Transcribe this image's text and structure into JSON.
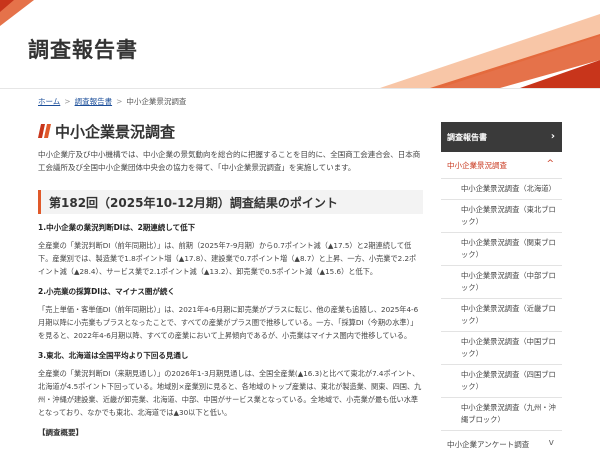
{
  "header": {
    "title": "調査報告書"
  },
  "breadcrumb": {
    "home": "ホーム",
    "reports": "調査報告書",
    "current": "中小企業景況調査",
    "separator": ">"
  },
  "main": {
    "title": "中小企業景況調査",
    "intro": "中小企業庁及び中小機構では、中小企業の景気動向を総合的に把握することを目的に、全国商工会連合会、日本商工会議所及び全国中小企業団体中央会の協力を得て、「中小企業景況調査」を実施しています。",
    "section_title": "第182回（2025年10-12月期）調査結果のポイント",
    "points": [
      {
        "heading": "1.中小企業の業況判断DIは、2期連続して低下",
        "body": "全産業の「業況判断DI（前年同期比）」は、前期（2025年7-9月期）から0.7ポイント減（▲17.5）と2期連続して低下。産業別では、製造業で1.8ポイント増（▲17.8）、建設業で0.7ポイント増（▲8.7）と上昇、一方、小売業で2.2ポイント減（▲28.4）、サービス業で2.1ポイント減（▲13.2）、卸売業で0.5ポイント減（▲15.6）と低下。"
      },
      {
        "heading": "2.小売業の採算DIは、マイナス圏が続く",
        "body": "「売上単価・客単価DI（前年同期比）」は、2021年4-6月期に卸売業がプラスに転じ、他の産業も追随し、2025年4-6月期以降に小売業もプラスとなったことで、すべての産業がプラス圏で推移している。一方、「採算DI（今期の水準）」を見ると、2022年4-6月期以降、すべての産業において上昇傾向であるが、小売業はマイナス圏内で推移している。"
      },
      {
        "heading": "3.東北、北海道は全国平均より下回る見通し",
        "body": "全産業の「業況判断DI（来期見通し）」の2026年1-3月期見通しは、全国全産業(▲16.3)と比べて東北が7.4ポイント、北海道が4.5ポイント下回っている。地域別×産業別に見ると、各地域のトップ産業は、東北が製造業、関東、四国、九州・沖縄が建設業、近畿が卸売業、北海道、中部、中国がサービス業となっている。全地域で、小売業が最も低い水準となっており、なかでも東北、北海道では▲30以下と低い。"
      }
    ],
    "outline": "【調査概要】"
  },
  "sidebar": {
    "header": "調査報告書",
    "header_chevron": "›",
    "active": "中小企業景況調査",
    "active_chevron": "^",
    "items": [
      "中小企業景況調査（北海道）",
      "中小企業景況調査（東北ブロック）",
      "中小企業景況調査（関東ブロック）",
      "中小企業景況調査（中部ブロック）",
      "中小企業景況調査（近畿ブロック）",
      "中小企業景況調査（中国ブロック）",
      "中小企業景況調査（四国ブロック）",
      "中小企業景況調査（九州・沖縄ブロック）"
    ],
    "other": "中小企業アンケート調査",
    "other_chevron": "v"
  },
  "colors": {
    "accent": "#e0592a",
    "accent_dark": "#c8351b",
    "sidebar_header": "#3a3a3a",
    "link": "#1a4d99"
  }
}
